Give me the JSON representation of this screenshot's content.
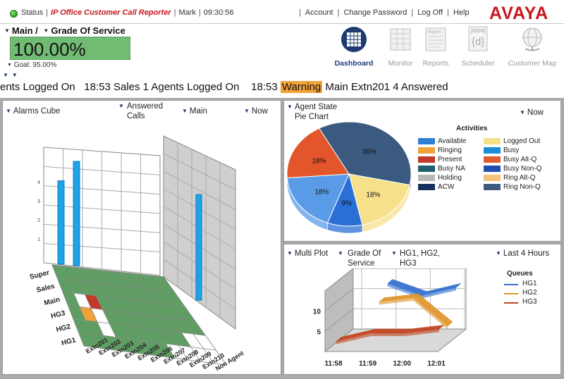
{
  "status": {
    "label": "Status",
    "app_title": "IP Office Customer Call Reporter",
    "user": "Mark",
    "time": "09:30:56"
  },
  "account_links": [
    "Account",
    "Change Password",
    "Log Off",
    "Help"
  ],
  "brand": {
    "logo_text": "AVAYA",
    "accent": "#c8161d"
  },
  "breadcrumb": {
    "level1": "Main /",
    "level2": "Grade Of Service"
  },
  "kpi": {
    "value": "100.00%",
    "goal": "Goal: 95.00%",
    "color": "#71bb73"
  },
  "nav": [
    {
      "label": "Dashboard",
      "icon": "dashboard-icon",
      "active": true
    },
    {
      "label": "Monitor",
      "icon": "monitor-icon",
      "active": false
    },
    {
      "label": "Reports",
      "icon": "reports-icon",
      "active": false
    },
    {
      "label": "Scheduler",
      "icon": "scheduler-icon",
      "active": false
    },
    {
      "label": "Customer Map",
      "icon": "customer-map-icon",
      "active": false
    }
  ],
  "nav_icon_texts": {
    "reports": "Report",
    "scheduler_top": "[MON]",
    "scheduler_big": "{d}"
  },
  "ticker": {
    "part1": "ents Logged On",
    "part2": "18:53 Sales 1 Agents Logged On",
    "time3": "18:53",
    "warning": "Warning",
    "part3": "Main Extn201 4 Answered",
    "warning_color": "#f2a23a"
  },
  "alarms_panel": {
    "controls": [
      "Alarms Cube",
      "Answered\nCalls",
      "Main",
      "Now"
    ],
    "y_labels": [
      "Super",
      "Sales",
      "Main",
      "HG3",
      "HG2",
      "HG1"
    ],
    "x_labels": [
      "Extn201",
      "Extn202",
      "Extn203",
      "Extn204",
      "Extn205",
      "Extn206",
      "Extn207",
      "Extn208",
      "Extn209",
      "Extn210",
      "Non Agent"
    ],
    "back_ticks": [
      "4",
      "3",
      "2",
      "1"
    ]
  },
  "pie_panel": {
    "controls": [
      "Agent State\nPie Chart",
      "Now"
    ],
    "legend_title": "Activities",
    "legend": [
      {
        "name": "Available",
        "color": "#2f7fd6"
      },
      {
        "name": "Logged Out",
        "color": "#f7e08a"
      },
      {
        "name": "Ringing",
        "color": "#f0a23a"
      },
      {
        "name": "Busy",
        "color": "#1d8bd6"
      },
      {
        "name": "Present",
        "color": "#c0392b"
      },
      {
        "name": "Busy Alt-Q",
        "color": "#e05d2f"
      },
      {
        "name": "Busy NA",
        "color": "#1f5f6f"
      },
      {
        "name": "Busy Non-Q",
        "color": "#1f4fb3"
      },
      {
        "name": "Holding",
        "color": "#b8b8b8"
      },
      {
        "name": "Ring Alt-Q",
        "color": "#f5c27a"
      },
      {
        "name": "ACW",
        "color": "#16305e"
      },
      {
        "name": "Ring Non-Q",
        "color": "#3e5b7f"
      }
    ]
  },
  "multi_panel": {
    "controls": [
      "Multi Plot",
      "Grade Of\nService",
      "HG1, HG2,\nHG3",
      "Last 4 Hours"
    ],
    "legend_title": "Queues"
  },
  "chart_data": [
    {
      "type": "pie",
      "title": "",
      "slices": [
        {
          "name": "ACW",
          "value": 36,
          "label": "36%",
          "color": "#3b5a80"
        },
        {
          "name": "Logged Out",
          "value": 18,
          "label": "18%",
          "color": "#f7e08a"
        },
        {
          "name": "Busy Non-Q",
          "value": 9,
          "label": "9%",
          "color": "#2a6fd6"
        },
        {
          "name": "Available",
          "value": 18,
          "label": "18%",
          "color": "#5a9be8"
        },
        {
          "name": "Busy Alt-Q",
          "value": 18,
          "label": "18%",
          "color": "#e3552a"
        }
      ]
    },
    {
      "type": "line",
      "title": "",
      "x": [
        "11:58",
        "11:59",
        "12:00",
        "12:01"
      ],
      "yticks": [
        "5",
        "10"
      ],
      "ylim": [
        0,
        15
      ],
      "series": [
        {
          "name": "HG1",
          "color": "#2f6ecf",
          "values": [
            null,
            13,
            10,
            12
          ]
        },
        {
          "name": "HG2",
          "color": "#e0952a",
          "values": [
            null,
            10,
            11,
            4
          ]
        },
        {
          "name": "HG3",
          "color": "#c2421c",
          "values": [
            2,
            4,
            4,
            5
          ]
        }
      ]
    },
    {
      "type": "bar",
      "title": "",
      "note": "3D alarms cube",
      "categories": [
        "Extn201",
        "Extn202",
        "Extn203",
        "Extn204",
        "Extn205",
        "Extn206",
        "Extn207",
        "Extn208",
        "Extn209",
        "Extn210",
        "Non Agent"
      ],
      "ylim": [
        0,
        5
      ],
      "back_values": [
        4,
        5,
        0,
        0,
        0,
        0,
        0,
        0,
        0,
        0,
        0
      ],
      "side_values": [
        0,
        0,
        0,
        0,
        5,
        0
      ]
    }
  ]
}
